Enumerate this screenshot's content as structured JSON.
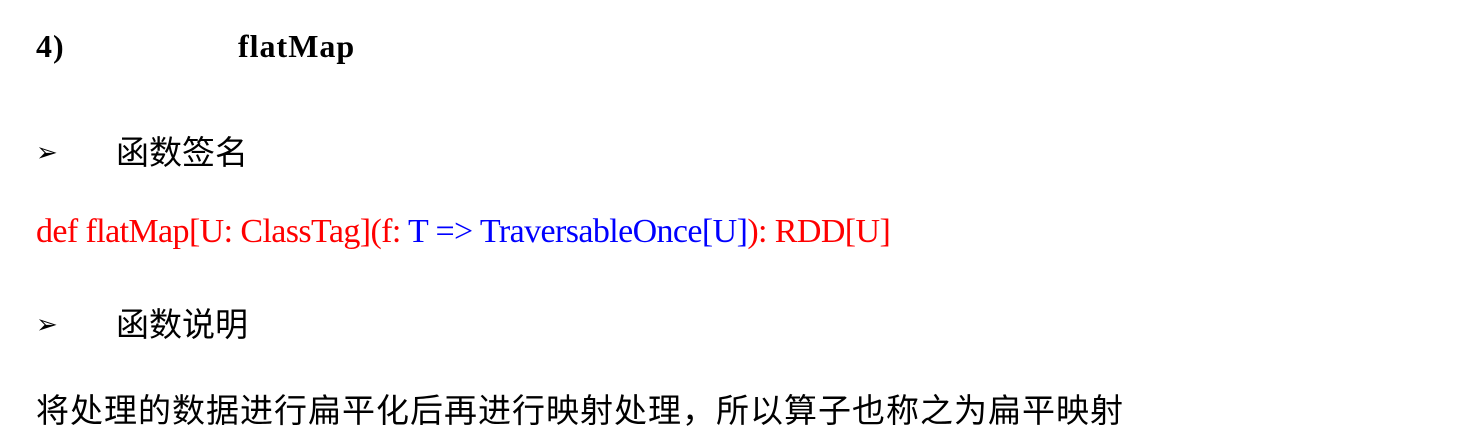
{
  "section": {
    "number": "4)",
    "title": "flatMap"
  },
  "bullets": {
    "marker": "➢",
    "signature_label": "函数签名",
    "description_label": "函数说明"
  },
  "signature": {
    "prefix": "def flatMap[U: ClassTag](f: ",
    "param_type": "T => TraversableOnce[U]",
    "suffix": "): RDD[U]"
  },
  "description": "将处理的数据进行扁平化后再进行映射处理，所以算子也称之为扁平映射",
  "colors": {
    "signature_main": "#ff0000",
    "signature_param": "#0000ff",
    "text": "#000000"
  }
}
